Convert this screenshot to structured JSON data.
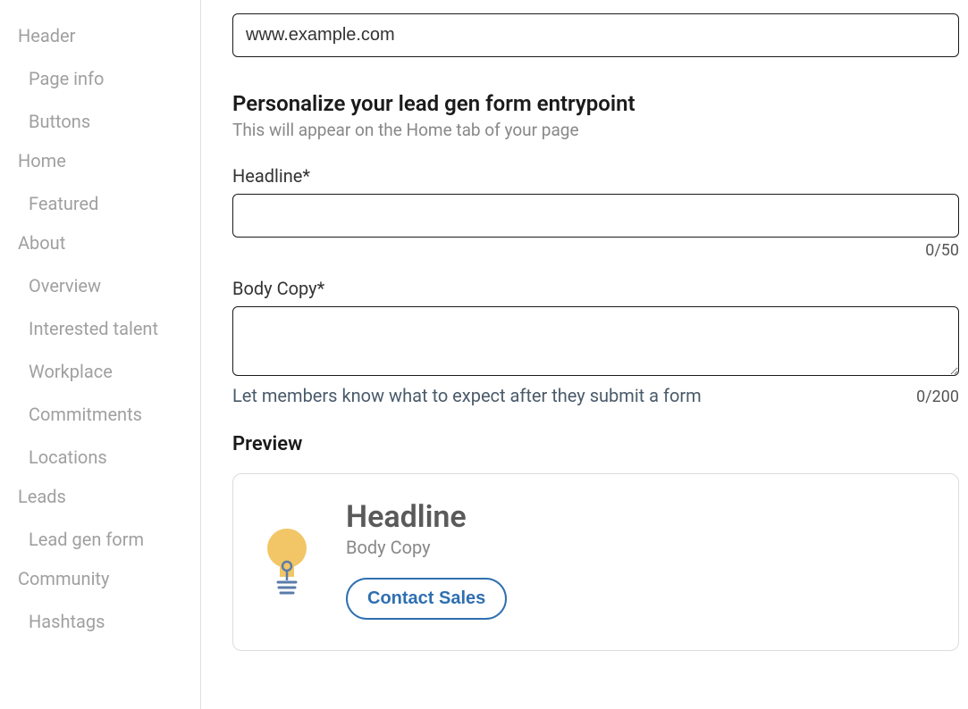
{
  "sidebar": {
    "groups": [
      {
        "heading": "Header",
        "items": [
          "Page info",
          "Buttons"
        ]
      },
      {
        "heading": "Home",
        "items": [
          "Featured"
        ]
      },
      {
        "heading": "About",
        "items": [
          "Overview",
          "Interested talent",
          "Workplace",
          "Commitments",
          "Locations"
        ]
      },
      {
        "heading": "Leads",
        "items": [
          "Lead gen form"
        ]
      },
      {
        "heading": "Community",
        "items": [
          "Hashtags"
        ]
      }
    ]
  },
  "main": {
    "url_value": "www.example.com",
    "section_title": "Personalize your lead gen form entrypoint",
    "section_subtitle": "This will appear on the Home tab of your page",
    "headline_label": "Headline*",
    "headline_value": "",
    "headline_counter": "0/50",
    "body_label": "Body Copy*",
    "body_value": "",
    "body_helper": "Let members know what to expect after they submit a form",
    "body_counter": "0/200",
    "preview_label": "Preview",
    "preview": {
      "headline": "Headline",
      "body": "Body Copy",
      "button": "Contact Sales"
    }
  }
}
